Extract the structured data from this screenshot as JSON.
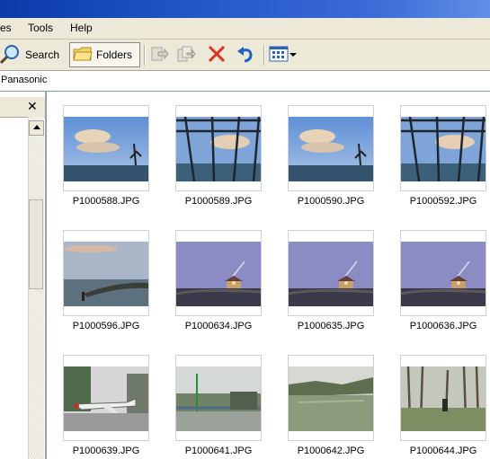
{
  "menubar": {
    "items": [
      "es",
      "Tools",
      "Help"
    ]
  },
  "toolbar": {
    "search_label": "Search",
    "folders_label": "Folders"
  },
  "address": {
    "text": "Panasonic"
  },
  "leftpane": {
    "close_glyph": "✕"
  },
  "thumbnails": [
    {
      "filename": "P1000588.JPG",
      "scene": "clouds-sea"
    },
    {
      "filename": "P1000589.JPG",
      "scene": "pergola-sea"
    },
    {
      "filename": "P1000590.JPG",
      "scene": "clouds-sea"
    },
    {
      "filename": "P1000592.JPG",
      "scene": "pergola-sea"
    },
    {
      "filename": "P1000596.JPG",
      "scene": "breakwater"
    },
    {
      "filename": "P1000634.JPG",
      "scene": "dusk-lamp"
    },
    {
      "filename": "P1000635.JPG",
      "scene": "dusk-lamp"
    },
    {
      "filename": "P1000636.JPG",
      "scene": "dusk-lamp"
    },
    {
      "filename": "P1000639.JPG",
      "scene": "jet-park"
    },
    {
      "filename": "P1000641.JPG",
      "scene": "canal-bridge"
    },
    {
      "filename": "P1000642.JPG",
      "scene": "river"
    },
    {
      "filename": "P1000644.JPG",
      "scene": "forest"
    }
  ]
}
